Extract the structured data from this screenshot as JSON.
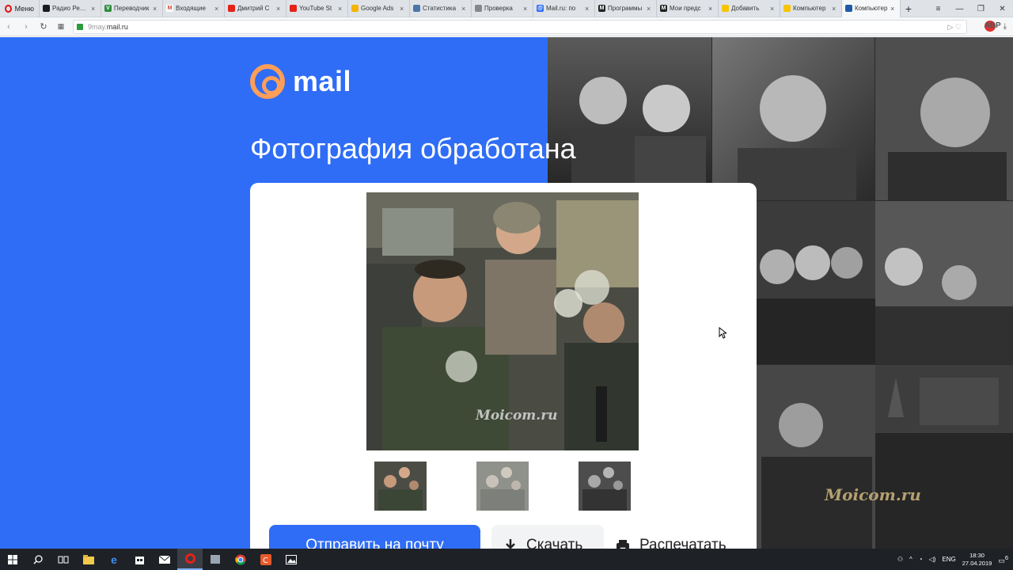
{
  "browser": {
    "menu_label": "Меню",
    "tabs": [
      {
        "title": "Радио Рекорд",
        "fav_color": "#1c1c1c",
        "fav_text": ""
      },
      {
        "title": "Переводчик",
        "fav_color": "#2d8c3c",
        "fav_text": "V"
      },
      {
        "title": "Входящие",
        "fav_color": "#ffffff",
        "fav_text": "M"
      },
      {
        "title": "Дмитрий С",
        "fav_color": "#e62117",
        "fav_text": ""
      },
      {
        "title": "YouTube St",
        "fav_color": "#e62117",
        "fav_text": ""
      },
      {
        "title": "Google Ads",
        "fav_color": "#f4b400",
        "fav_text": ""
      },
      {
        "title": "Статистика",
        "fav_color": "#4a76a8",
        "fav_text": ""
      },
      {
        "title": "Проверка",
        "fav_color": "#888888",
        "fav_text": ""
      },
      {
        "title": "Mail.ru: по",
        "fav_color": "#2f6df6",
        "fav_text": "@"
      },
      {
        "title": "Программы",
        "fav_color": "#222222",
        "fav_text": "M"
      },
      {
        "title": "Мои предс",
        "fav_color": "#222222",
        "fav_text": "M"
      },
      {
        "title": "Добавить",
        "fav_color": "#f7c400",
        "fav_text": ""
      },
      {
        "title": "Компьютер",
        "fav_color": "#f7c400",
        "fav_text": ""
      },
      {
        "title": "Компьютер",
        "fav_color": "#1e5aa8",
        "fav_text": ""
      }
    ],
    "url_sub": "9may.",
    "url_main": "mail.ru",
    "new_tab": "+",
    "close_glyph": "×"
  },
  "page": {
    "logo_text": "mail",
    "heading": "Фотография обработана",
    "watermark": "Moicom.ru",
    "collage_watermark": "Moicom.ru",
    "send_button": "Отправить на почту",
    "download_button": "Скачать",
    "print_button": "Распечатать",
    "accent_color": "#2f6df6",
    "logo_color": "#ff9e58"
  },
  "taskbar": {
    "lang": "ENG",
    "time": "18:30",
    "date": "27.04.2019",
    "notification_count": "6"
  }
}
